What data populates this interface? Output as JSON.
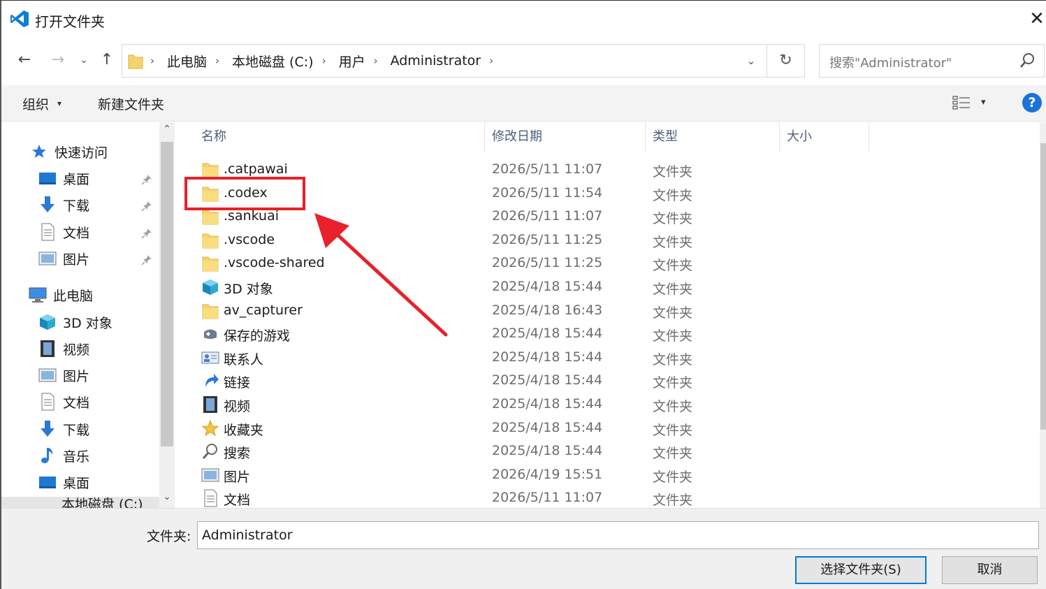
{
  "window": {
    "title": "打开文件夹",
    "close_glyph": "✕"
  },
  "nav": {
    "back_glyph": "←",
    "forward_glyph": "→",
    "recent_glyph": "⌄",
    "up_glyph": "↑",
    "breadcrumbs": [
      "此电脑",
      "本地磁盘 (C:)",
      "用户",
      "Administrator"
    ],
    "crumb_separator": "›",
    "dropdown_glyph": "⌄",
    "refresh_glyph": "↻",
    "search_placeholder": "搜索\"Administrator\""
  },
  "toolbar": {
    "organize_label": "组织",
    "organize_arrow": "▾",
    "new_folder_label": "新建文件夹",
    "view_arrow": "▾",
    "help_label": "?"
  },
  "sidebar": {
    "scroll_up": "⌃",
    "scroll_down": "⌄",
    "quick_access": "快速访问",
    "quick_items": [
      {
        "label": "桌面",
        "icon": "desktop-icon",
        "pinned": true
      },
      {
        "label": "下载",
        "icon": "download-icon",
        "pinned": true
      },
      {
        "label": "文档",
        "icon": "document-icon",
        "pinned": true
      },
      {
        "label": "图片",
        "icon": "picture-icon",
        "pinned": true
      }
    ],
    "this_pc": "此电脑",
    "pc_items": [
      {
        "label": "3D 对象",
        "icon": "3d-objects-icon"
      },
      {
        "label": "视频",
        "icon": "video-icon"
      },
      {
        "label": "图片",
        "icon": "picture-icon"
      },
      {
        "label": "文档",
        "icon": "document-icon"
      },
      {
        "label": "下载",
        "icon": "download-icon"
      },
      {
        "label": "音乐",
        "icon": "music-icon"
      },
      {
        "label": "桌面",
        "icon": "desktop-icon"
      }
    ],
    "partial_item": "本地磁盘 (C:)",
    "pin_glyph": "📌"
  },
  "filelist": {
    "sort_glyph": "^",
    "columns": {
      "name": "名称",
      "modified": "修改日期",
      "type": "类型",
      "size": "大小"
    },
    "rows": [
      {
        "name": ".catpawai",
        "date": "2026/5/11 11:07",
        "type": "文件夹",
        "icon": "folder-icon"
      },
      {
        "name": ".codex",
        "date": "2026/5/11 11:54",
        "type": "文件夹",
        "icon": "folder-icon"
      },
      {
        "name": ".sankuai",
        "date": "2026/5/11 11:07",
        "type": "文件夹",
        "icon": "folder-icon"
      },
      {
        "name": ".vscode",
        "date": "2026/5/11 11:25",
        "type": "文件夹",
        "icon": "folder-icon"
      },
      {
        "name": ".vscode-shared",
        "date": "2026/5/11 11:25",
        "type": "文件夹",
        "icon": "folder-icon"
      },
      {
        "name": "3D 对象",
        "date": "2025/4/18 15:44",
        "type": "文件夹",
        "icon": "3d-objects-icon"
      },
      {
        "name": "av_capturer",
        "date": "2025/4/18 16:43",
        "type": "文件夹",
        "icon": "folder-icon"
      },
      {
        "name": "保存的游戏",
        "date": "2025/4/18 15:44",
        "type": "文件夹",
        "icon": "saved-games-icon"
      },
      {
        "name": "联系人",
        "date": "2025/4/18 15:44",
        "type": "文件夹",
        "icon": "contacts-icon"
      },
      {
        "name": "链接",
        "date": "2025/4/18 15:44",
        "type": "文件夹",
        "icon": "links-icon"
      },
      {
        "name": "视频",
        "date": "2025/4/18 15:44",
        "type": "文件夹",
        "icon": "video-icon"
      },
      {
        "name": "收藏夹",
        "date": "2025/4/18 15:44",
        "type": "文件夹",
        "icon": "favorites-icon"
      },
      {
        "name": "搜索",
        "date": "2025/4/18 15:44",
        "type": "文件夹",
        "icon": "search-folder-icon"
      },
      {
        "name": "图片",
        "date": "2026/4/19 15:51",
        "type": "文件夹",
        "icon": "picture-icon"
      },
      {
        "name": "文档",
        "date": "2026/5/11 11:07",
        "type": "文件夹",
        "icon": "document-icon"
      }
    ]
  },
  "footer": {
    "folder_label": "文件夹:",
    "folder_value": "Administrator",
    "select_button": "选择文件夹(S)",
    "cancel_button": "取消"
  },
  "colors": {
    "accent": "#0078d7",
    "folder": "#f6d36b",
    "annotation": "#e8212a",
    "help": "#1a73d9"
  }
}
